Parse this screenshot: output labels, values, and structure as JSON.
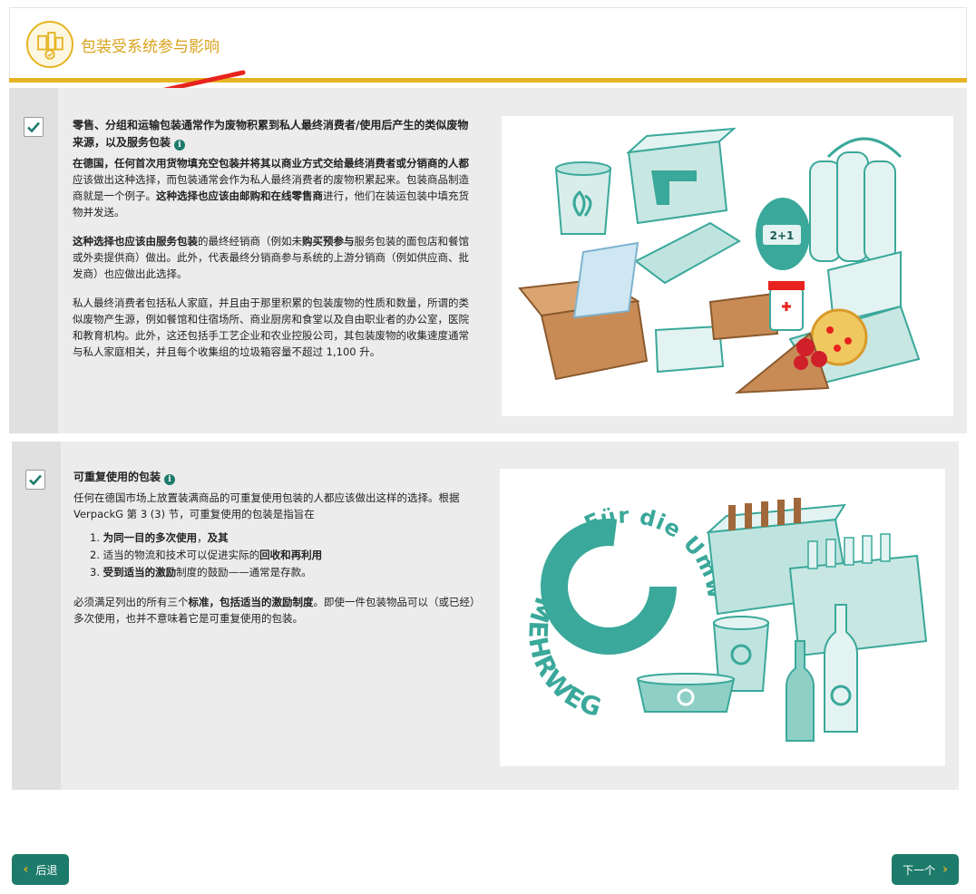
{
  "header": {
    "title": "包装受系统参与影响"
  },
  "section1": {
    "checked": true,
    "heading": "零售、分组和运输包装通常作为废物积累到私人最终消费者/使用后产生的类似废物来源，以及服务包装",
    "p1_b1": "在德国，任何首次用货物填充空包装并将其以商业方式交给最终消费者或分销商的人都",
    "p1_t1": "应该做出这种选择，而包装通常会作为私人最终消费者的废物积累起来。包装商品制造商就是一个例子。",
    "p1_b2": "这种选择也应该由邮购和在线零售商",
    "p1_t2": "进行，他们在装运包装中填充货物并发送。",
    "p2_b1": "这种选择也应该由服务包装",
    "p2_t1": "的最终经销商（例如未",
    "p2_b2": "购买预参与",
    "p2_t2": "服务包装的面包店和餐馆或外卖提供商）做出。此外，代表最终分销商参与系统的上游分销商（例如供应商、批发商）也应做出此选择。",
    "p3": "私人最终消费者包括私人家庭，并且由于那里积累的包装废物的性质和数量，所谓的类似废物产生源，例如餐馆和住宿场所、商业厨房和食堂以及自由职业者的办公室，医院和教育机构。此外，这还包括手工艺企业和农业控股公司，其包装废物的收集速度通常与私人家庭相关，并且每个收集组的垃圾箱容量不超过 1,100 升。",
    "image_labels": {
      "badge": "2+1"
    }
  },
  "section2": {
    "checked": true,
    "heading": "可重复使用的包装",
    "p1": "任何在德国市场上放置装满商品的可重复使用包装的人都应该做出这样的选择。根据 VerpackG 第 3 (3) 节，可重复使用的包装是指旨在",
    "list": [
      {
        "n": "1. ",
        "b": "为同一目的多次使用",
        "t": "，",
        "b2": "及其"
      },
      {
        "n": "2. ",
        "t": "适当的物流和技术可以促进实际的",
        "b": "回收和再利用"
      },
      {
        "n": "3. ",
        "b": "受到适当的激励",
        "t": "制度的鼓励——通常是存款。"
      }
    ],
    "p2_t1": "必须满足列出的所有三个",
    "p2_b1": "标准，包括适当的激励制度",
    "p2_t2": "。即使一件包装物品可以（或已经）多次使用，也并不意味着它是可重复使用的包装。",
    "image_labels": {
      "ring_top": "Für die Umwelt",
      "ring_bottom": "MEHRWEG"
    }
  },
  "nav": {
    "back_label": "后退",
    "next_label": "下一个"
  },
  "colors": {
    "accent": "#e6b422",
    "teal": "#1d7b6b",
    "illustration_teal": "#3aa89a"
  }
}
